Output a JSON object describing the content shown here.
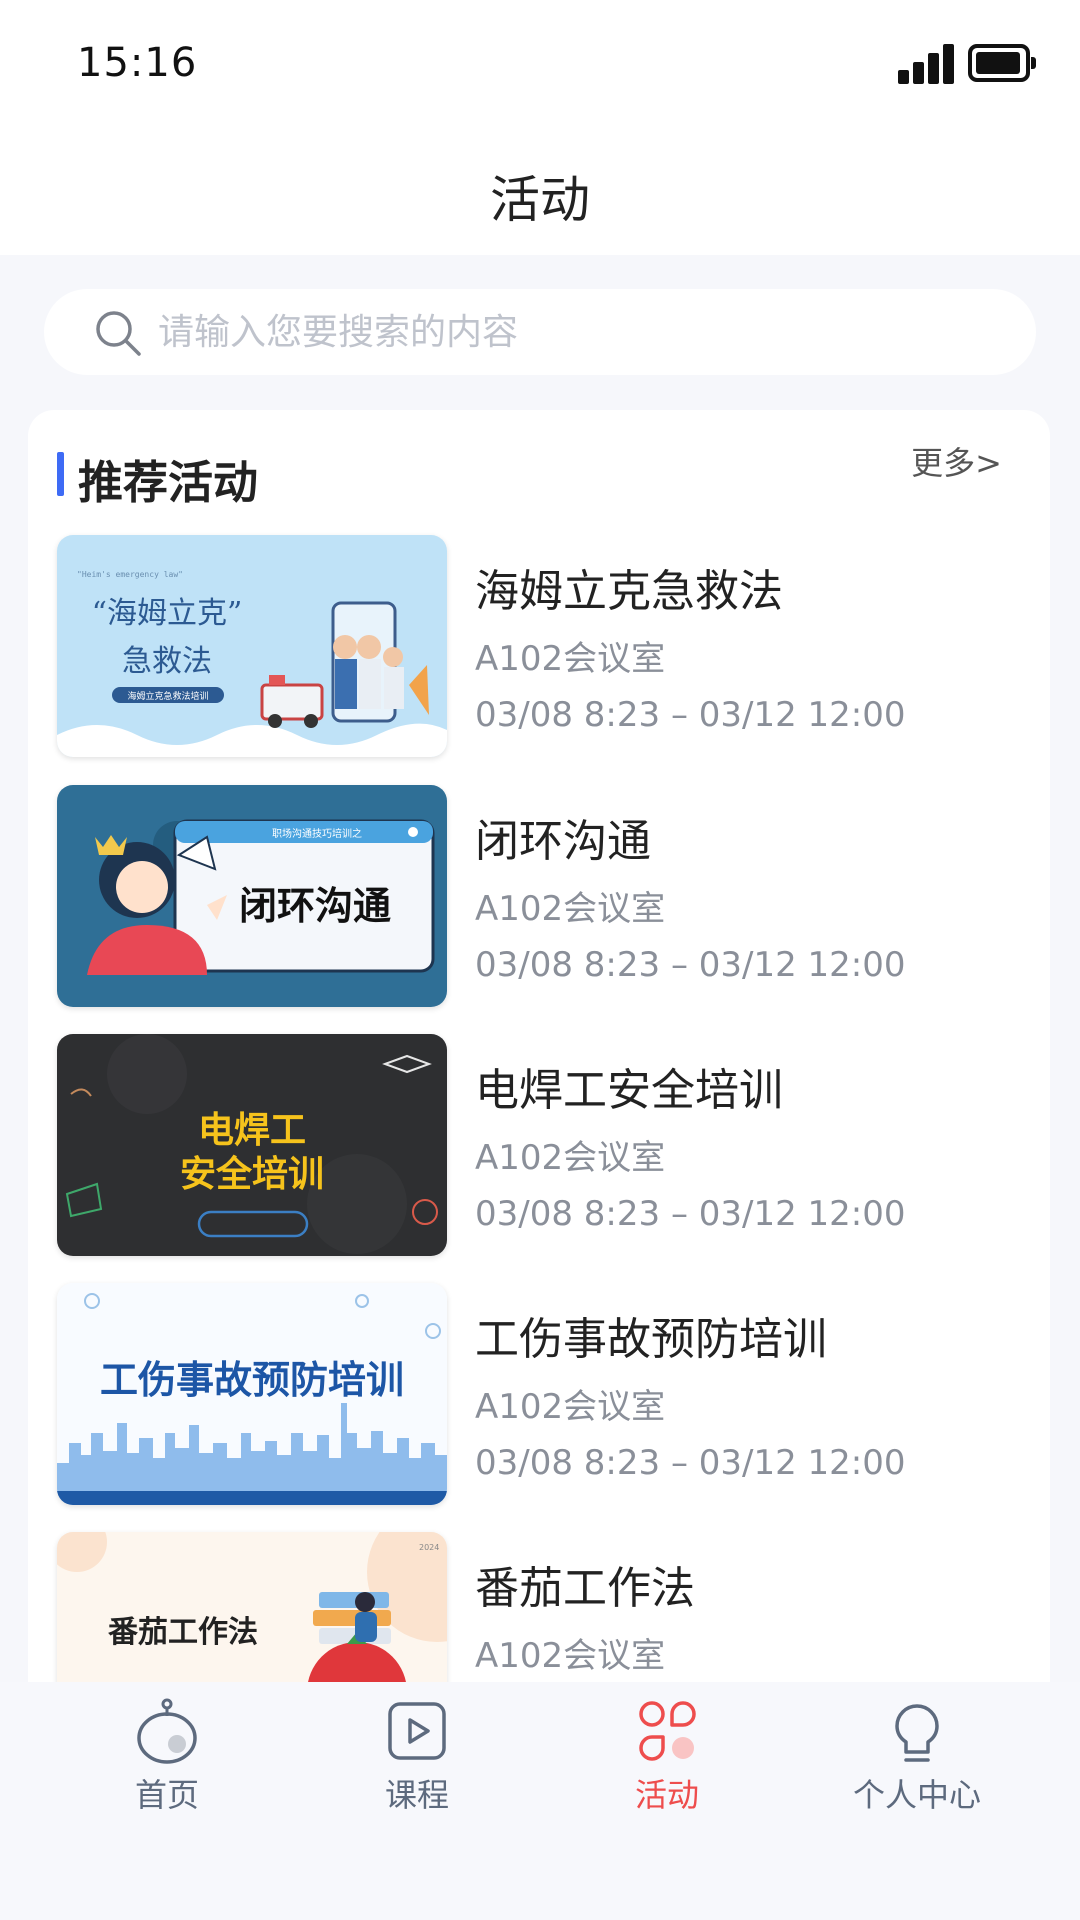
{
  "status_bar": {
    "time": "15:16"
  },
  "header": {
    "title": "活动"
  },
  "search": {
    "placeholder": "请输入您要搜索的内容"
  },
  "section": {
    "title": "推荐活动",
    "more_label": "更多>"
  },
  "activities": [
    {
      "title": "海姆立克急救法",
      "location": "A102会议室",
      "time": "03/08 8:23 – 03/12 12:00",
      "thumb": {
        "line1": "“海姆立克”",
        "line2": "急救法",
        "small_top": "\"Heim's emergency law\"",
        "small_badge": "海姆立克急救法培训"
      }
    },
    {
      "title": "闭环沟通",
      "location": "A102会议室",
      "time": "03/08 8:23 – 03/12 12:00",
      "thumb": {
        "header": "职场沟通技巧培训之",
        "main": "闭环沟通"
      }
    },
    {
      "title": "电焊工安全培训",
      "location": "A102会议室",
      "time": "03/08 8:23 – 03/12 12:00",
      "thumb": {
        "line1": "电焊工",
        "line2": "安全培训"
      }
    },
    {
      "title": "工伤事故预防培训",
      "location": "A102会议室",
      "time": "03/08 8:23 – 03/12 12:00",
      "thumb": {
        "main": "工伤事故预防培训"
      }
    },
    {
      "title": "番茄工作法",
      "location": "A102会议室",
      "time": "",
      "thumb": {
        "main": "番茄工作法",
        "year": "2024"
      }
    }
  ],
  "tabs": [
    {
      "label": "首页",
      "icon": "home-robot-icon",
      "active": false
    },
    {
      "label": "课程",
      "icon": "play-square-icon",
      "active": false
    },
    {
      "label": "活动",
      "icon": "activity-circles-icon",
      "active": true
    },
    {
      "label": "个人中心",
      "icon": "person-bulb-icon",
      "active": false
    }
  ],
  "colors": {
    "accent_blue": "#3e6bf5",
    "active_tab": "#ee4d4d",
    "inactive_tab": "#5d6a7e",
    "muted_text": "#8a8f99"
  }
}
